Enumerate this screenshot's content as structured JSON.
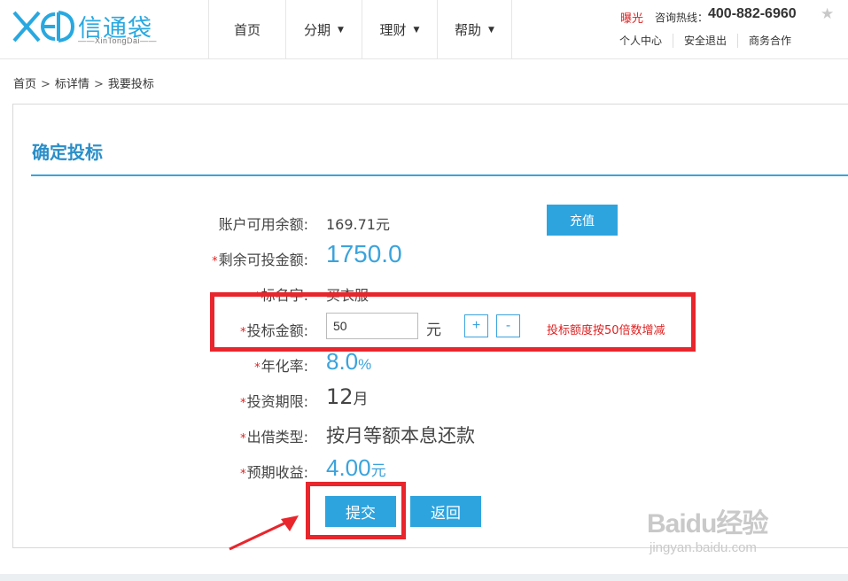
{
  "header": {
    "logo": {
      "text": "信通袋",
      "subtitle": "XinTongDai",
      "mark": "XED"
    },
    "nav": [
      {
        "label": "首页",
        "has_dropdown": false
      },
      {
        "label": "分期",
        "has_dropdown": true
      },
      {
        "label": "理财",
        "has_dropdown": true
      },
      {
        "label": "帮助",
        "has_dropdown": true
      }
    ],
    "exposure": "曝光",
    "hotline_label": "咨询热线：",
    "hotline": "400-882-6960",
    "user_links": [
      "个人中心",
      "安全退出",
      "商务合作"
    ]
  },
  "breadcrumb": [
    "首页",
    "标详情",
    "我要投标"
  ],
  "panel": {
    "title": "确定投标",
    "balance_label": "账户可用余额:",
    "balance_value": "169.71元",
    "recharge_label": "充值",
    "remaining_label": "剩余可投金额:",
    "remaining_value": "1750.0",
    "name_label": "标名字:",
    "name_value": "买衣服",
    "amount_label": "投标金额:",
    "amount_value": "50",
    "amount_unit": "元",
    "plus_label": "+",
    "minus_label": "-",
    "amount_hint": "投标额度按50倍数增减",
    "rate_label": "年化率:",
    "rate_value": "8.0",
    "rate_unit": "%",
    "period_label": "投资期限:",
    "period_value": "12",
    "period_unit": "月",
    "repay_label": "出借类型:",
    "repay_value": "按月等额本息还款",
    "income_label": "预期收益:",
    "income_value": "4.00",
    "income_unit": "元",
    "submit_label": "提交",
    "back_label": "返回",
    "required_mark": "*"
  },
  "watermark": {
    "main": "Baidu经验",
    "sub": "jingyan.baidu.com"
  },
  "colors": {
    "accent": "#2ea4df",
    "title": "#2a8ec8",
    "required": "#e02020",
    "highlight": "#e8262c"
  }
}
